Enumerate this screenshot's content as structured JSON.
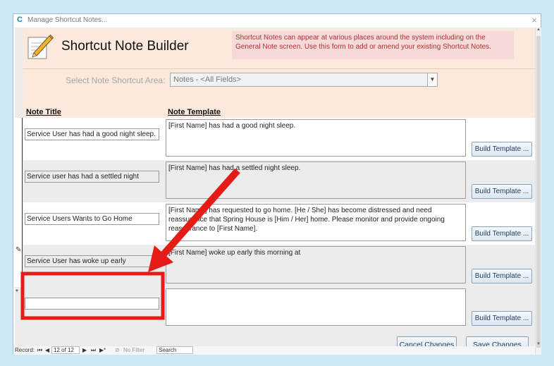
{
  "window": {
    "app_icon": "C",
    "title": "Manage Shortcut Notes...",
    "close": "×"
  },
  "header": {
    "title": "Shortcut Note Builder",
    "info": "Shortcut Notes can appear at various places around the system including on the General Note screen.  Use this form to add or amend your existing Shortcut Notes.",
    "area_label": "Select Note Shortcut Area:",
    "area_value": "Notes - <All Fields>",
    "col_title": "Note Title",
    "col_template": "Note Template"
  },
  "rows": [
    {
      "title": "Service User has had a good night sleep.",
      "template": "[First Name] has had a good night sleep.",
      "button": "Build Template ...",
      "marker": ""
    },
    {
      "title": "Service user has had a settled night",
      "template": "[First Name] has had a settled night sleep.",
      "button": "Build Template ...",
      "marker": ""
    },
    {
      "title": "Service Users Wants to Go Home",
      "template": "[First Name] has requested to go home. [He / She] has become distressed and need reassurance that Spring House is [Him / Her] home.  Please monitor and provide ongoing reassurance to [First Name].",
      "button": "Build Template ...",
      "marker": ""
    },
    {
      "title": "Service User has woke up early",
      "template": "[First Name] woke up early this morning at",
      "button": "Build Template ...",
      "marker": "✎"
    },
    {
      "title": "",
      "template": "",
      "button": "Build Template ...",
      "marker": "*"
    }
  ],
  "footer": {
    "cancel": "Cancel Changes",
    "save": "Save Changes"
  },
  "navbar": {
    "record_label": "Record:",
    "first": "⏮",
    "prev": "◀",
    "position": "12 of 12",
    "next": "▶",
    "last": "⏭",
    "new": "▶*",
    "filter": "No Filter",
    "search": "Search"
  },
  "annotation": {
    "highlight_color": "#e41b17"
  }
}
